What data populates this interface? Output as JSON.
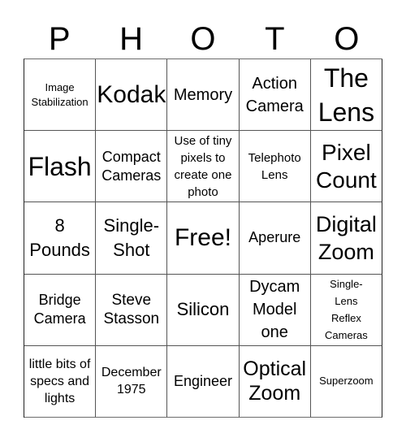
{
  "title_letters": [
    "P",
    "H",
    "O",
    "T",
    "O"
  ],
  "board": {
    "rows": [
      [
        "Image Stabilization",
        "Kodak",
        "Memory",
        "Action Camera",
        "The Lens"
      ],
      [
        "Flash",
        "Compact Cameras",
        "Use of tiny pixels to create one photo",
        "Telephoto Lens",
        "Pixel Count"
      ],
      [
        "8 Pounds",
        "Single-Shot",
        "Free!",
        "Aperure",
        "Digital Zoom"
      ],
      [
        "Bridge Camera",
        "Steve Stasson",
        "Silicon",
        "Dycam Model one",
        "Single-Lens Reflex Cameras"
      ],
      [
        "little bits of specs and lights",
        "December 1975",
        "Engineer",
        "Optical Zoom",
        "Superzoom"
      ]
    ],
    "free_space": "Free!"
  },
  "colors": {
    "grid_line": "#555555",
    "text": "#000000",
    "background": "#ffffff"
  }
}
